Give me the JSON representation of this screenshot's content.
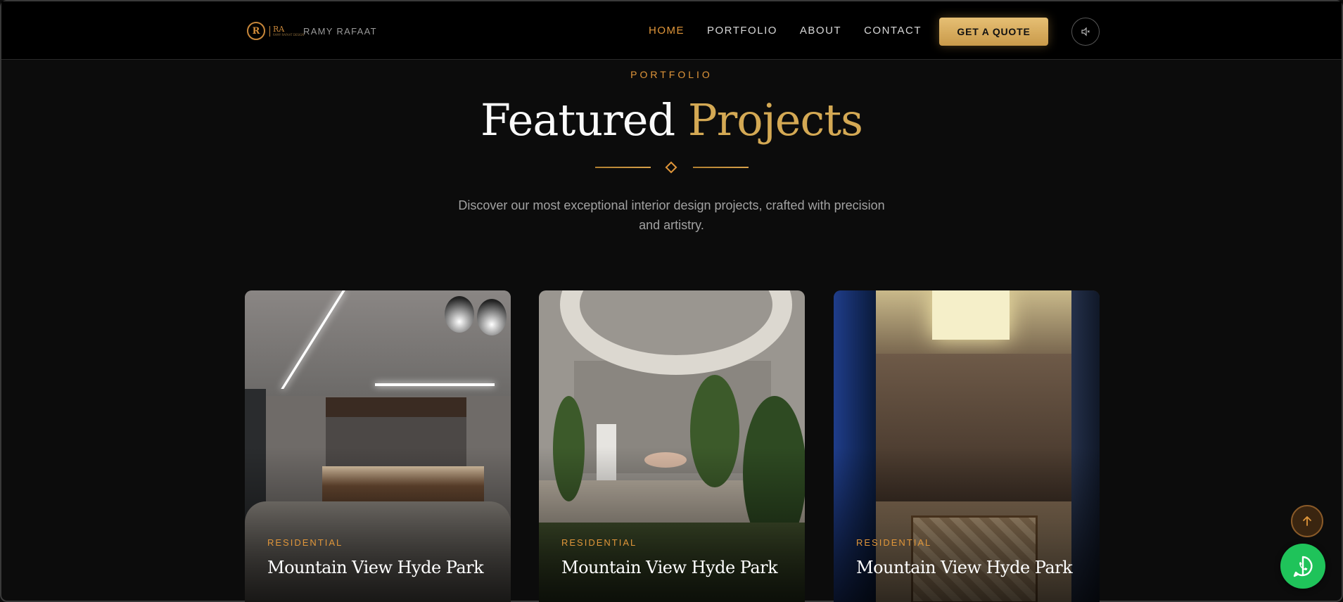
{
  "brand": {
    "logo_mark": "R",
    "logo_text": "RA",
    "logo_subtext": "RAMY RAFAAT DESIGN",
    "name": "RAMY RAFAAT"
  },
  "nav": {
    "items": [
      {
        "label": "HOME",
        "active": true
      },
      {
        "label": "PORTFOLIO",
        "active": false
      },
      {
        "label": "ABOUT",
        "active": false
      },
      {
        "label": "CONTACT",
        "active": false
      }
    ],
    "quote_button": "GET A QUOTE",
    "sound_icon": "speaker-muted-icon"
  },
  "section": {
    "eyebrow": "PORTFOLIO",
    "title_part1": "Featured",
    "title_part2": "Projects",
    "subtitle": "Discover our most exceptional interior design projects, crafted with precision and artistry."
  },
  "projects": [
    {
      "category": "RESIDENTIAL",
      "title": "Mountain View Hyde Park"
    },
    {
      "category": "RESIDENTIAL",
      "title": "Mountain View Hyde Park"
    },
    {
      "category": "RESIDENTIAL",
      "title": "Mountain View Hyde Park"
    }
  ],
  "floating": {
    "scroll_top_icon": "arrow-up-icon",
    "whatsapp_icon": "whatsapp-icon"
  },
  "colors": {
    "accent": "#e0963a",
    "gold": "#d4a954",
    "background": "#0c0c0c",
    "whatsapp": "#1fc35a"
  }
}
